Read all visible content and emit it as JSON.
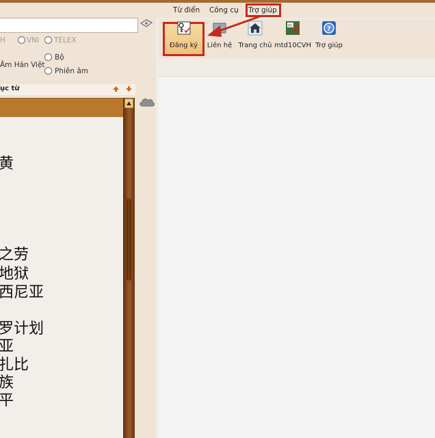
{
  "search": {
    "value": ""
  },
  "input_modes": {
    "first_cut": "H",
    "vni": "VNI",
    "telex": "TELEX"
  },
  "lookup_options": {
    "han_viet_cut": "Âm Hán Việt",
    "bo": "Bộ",
    "phien_am": "Phiên âm"
  },
  "list_heading": "ục từ",
  "results": [
    "黄",
    "之劳",
    "地狱",
    "西尼亚",
    "罗计划",
    "亚",
    "扎比",
    "族",
    "平"
  ],
  "menu": {
    "items": [
      "Từ điển",
      "Công cụ",
      "Trợ giúp"
    ]
  },
  "toolbar": {
    "items": [
      {
        "label": "Đăng ký",
        "icon": "key-register-icon"
      },
      {
        "label": "Liên hệ",
        "icon": "contact-icon"
      },
      {
        "label": "Trang chủ",
        "icon": "home-icon"
      },
      {
        "label": "mtd10CVH",
        "icon": "mtd-app-icon"
      },
      {
        "label": "Trợ giúp",
        "icon": "help-icon"
      }
    ]
  },
  "colors": {
    "accent_brown": "#b8782e",
    "highlight_red": "#c42a1e"
  }
}
